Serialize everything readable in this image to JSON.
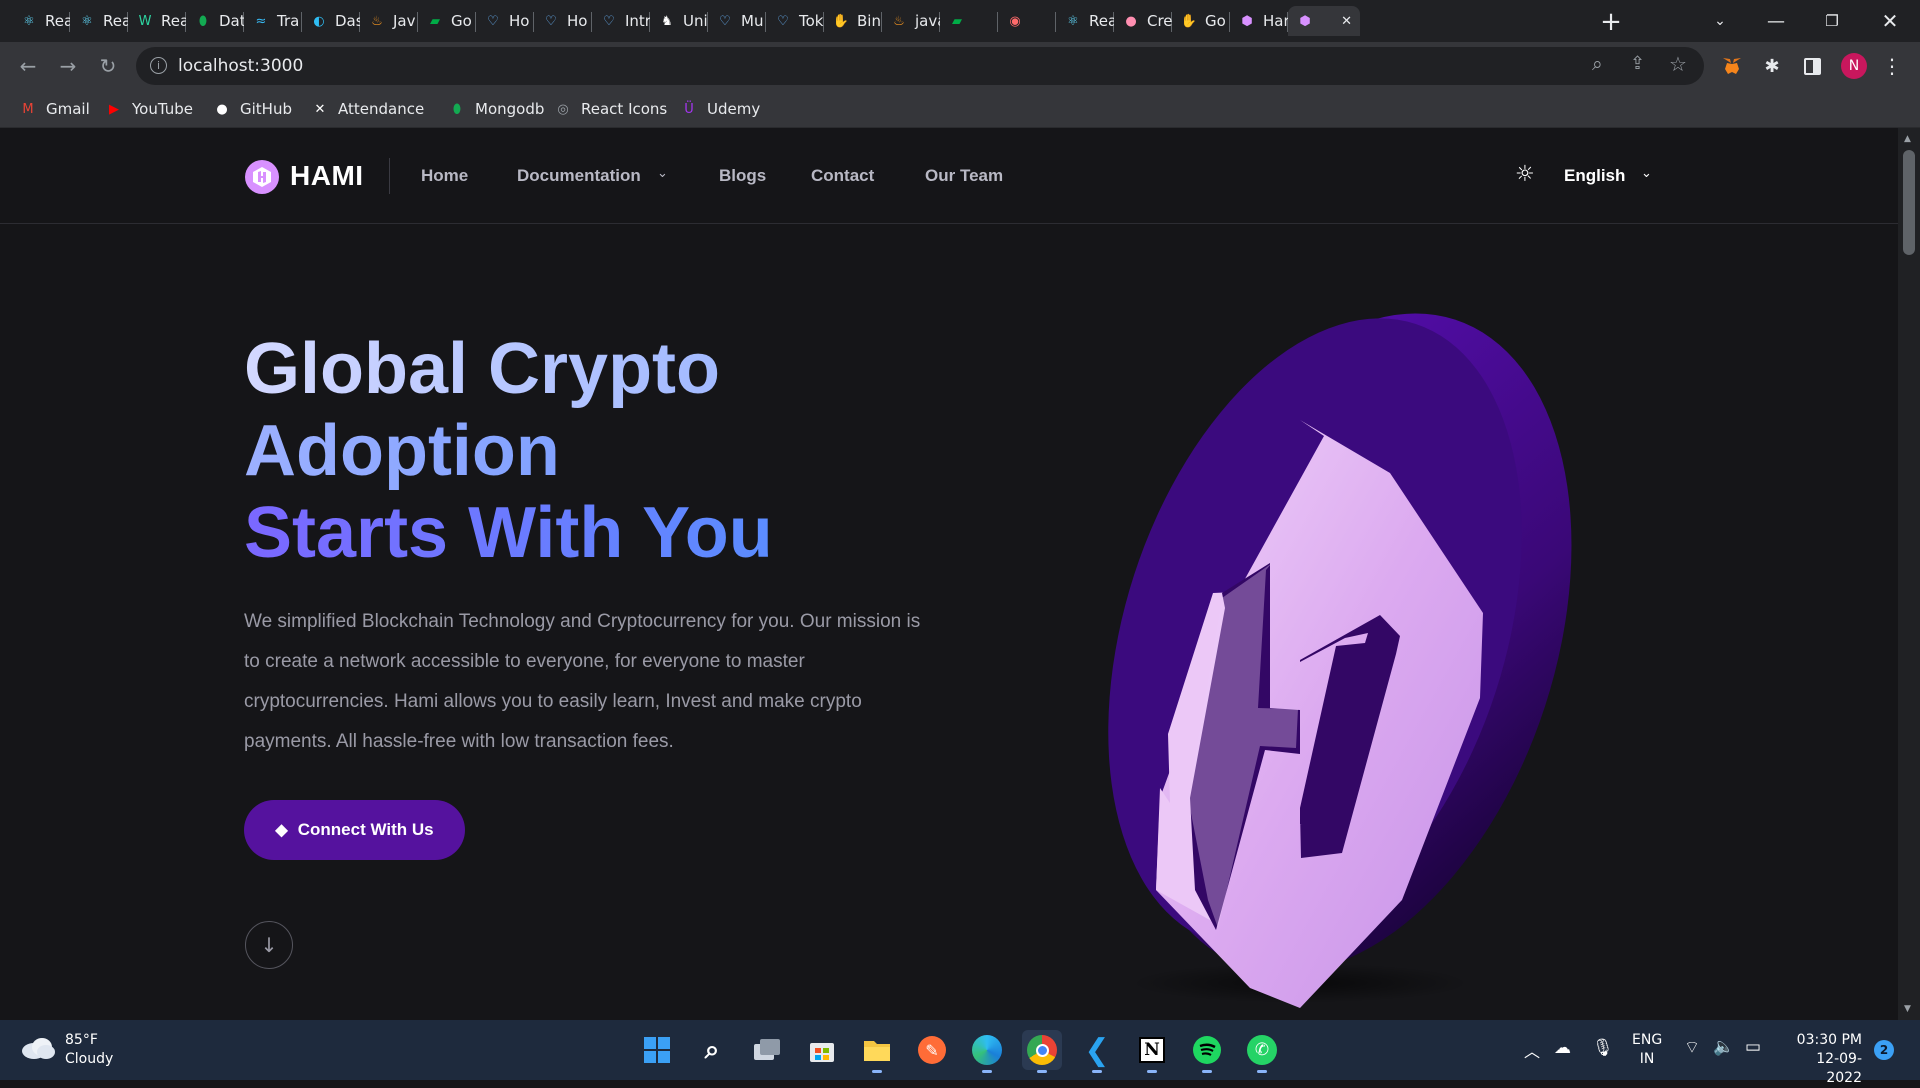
{
  "browser": {
    "tabs": [
      {
        "label": "Rea",
        "icon": "react-icon",
        "color": "#61dafb"
      },
      {
        "label": "Rea",
        "icon": "react-icon",
        "color": "#61dafb"
      },
      {
        "label": "Rea",
        "icon": "webflow-icon",
        "color": "#2dd4a0"
      },
      {
        "label": "Dat",
        "icon": "mongodb-leaf-icon",
        "color": "#13aa52"
      },
      {
        "label": "Tra",
        "icon": "tailwind-icon",
        "color": "#38bdf8"
      },
      {
        "label": "Das",
        "icon": "edge-icon",
        "color": "#2fbdf3"
      },
      {
        "label": "Jav",
        "icon": "java-icon",
        "color": "#f89820"
      },
      {
        "label": "Go",
        "icon": "meet-icon",
        "color": "#00ac47"
      },
      {
        "label": "Ho",
        "icon": "heart-icon",
        "color": "#6bb7ff"
      },
      {
        "label": "Ho",
        "icon": "heart-icon",
        "color": "#6bb7ff"
      },
      {
        "label": "Intr",
        "icon": "heart-icon",
        "color": "#6bb7ff"
      },
      {
        "label": "Uni",
        "icon": "unicorn-icon",
        "color": "#ffffff"
      },
      {
        "label": "Mu",
        "icon": "heart-icon",
        "color": "#6bb7ff"
      },
      {
        "label": "Tok",
        "icon": "heart-icon",
        "color": "#6bb7ff"
      },
      {
        "label": "Bin",
        "icon": "hand-icon",
        "color": "#f5f5f5"
      },
      {
        "label": "java",
        "icon": "java-icon",
        "color": "#f89820"
      },
      {
        "label": "",
        "icon": "meet-icon",
        "color": "#00ac47"
      },
      {
        "label": "",
        "icon": "record-icon",
        "color": "#ff6b6b"
      },
      {
        "label": "Rea",
        "icon": "react-icon",
        "color": "#61dafb"
      },
      {
        "label": "Cre",
        "icon": "circle-icon",
        "color": "#ff8fb1"
      },
      {
        "label": "Go",
        "icon": "hand-icon",
        "color": "#f5f5f5"
      },
      {
        "label": "Har",
        "icon": "hami-icon",
        "color": "#d891ff"
      },
      {
        "label": "",
        "icon": "hami-icon",
        "color": "#d891ff"
      }
    ],
    "url": "localhost:3000",
    "bookmarks": [
      {
        "label": "Gmail",
        "icon": "gmail-icon",
        "color": "#ea4335"
      },
      {
        "label": "YouTube",
        "icon": "youtube-icon",
        "color": "#ff0000"
      },
      {
        "label": "GitHub",
        "icon": "github-icon",
        "color": "#ffffff"
      },
      {
        "label": "Attendance",
        "icon": "x-icon",
        "color": "#ffffff"
      },
      {
        "label": "Mongodb",
        "icon": "mongodb-leaf-icon",
        "color": "#13aa52"
      },
      {
        "label": "React Icons",
        "icon": "react-icons-icon",
        "color": "#9aa0a6"
      },
      {
        "label": "Udemy",
        "icon": "udemy-icon",
        "color": "#a435f0"
      }
    ],
    "profile_initial": "N"
  },
  "site": {
    "brand": "HAMI",
    "nav": {
      "home": "Home",
      "documentation": "Documentation",
      "blogs": "Blogs",
      "contact": "Contact",
      "team": "Our Team"
    },
    "language": "English",
    "hero": {
      "line1": "Global Crypto",
      "line2": "Adoption",
      "line3": "Starts With You",
      "description": "We simplified Blockchain Technology and Cryptocurrency for you. Our mission is to create a network accessible to everyone, for everyone to master cryptocurrencies. Hami allows you to easily learn, Invest and make crypto payments. All hassle-free with low transaction fees.",
      "cta": "Connect With Us"
    },
    "accent_colors": {
      "button": "#55129e",
      "coin_light": "#e4b8f5",
      "coin_dark": "#3c0a7a"
    }
  },
  "taskbar": {
    "weather_temp": "85°F",
    "weather_cond": "Cloudy",
    "lang_line1": "ENG",
    "lang_line2": "IN",
    "time": "03:30 PM",
    "date": "12-09-2022",
    "notification_count": "2"
  }
}
